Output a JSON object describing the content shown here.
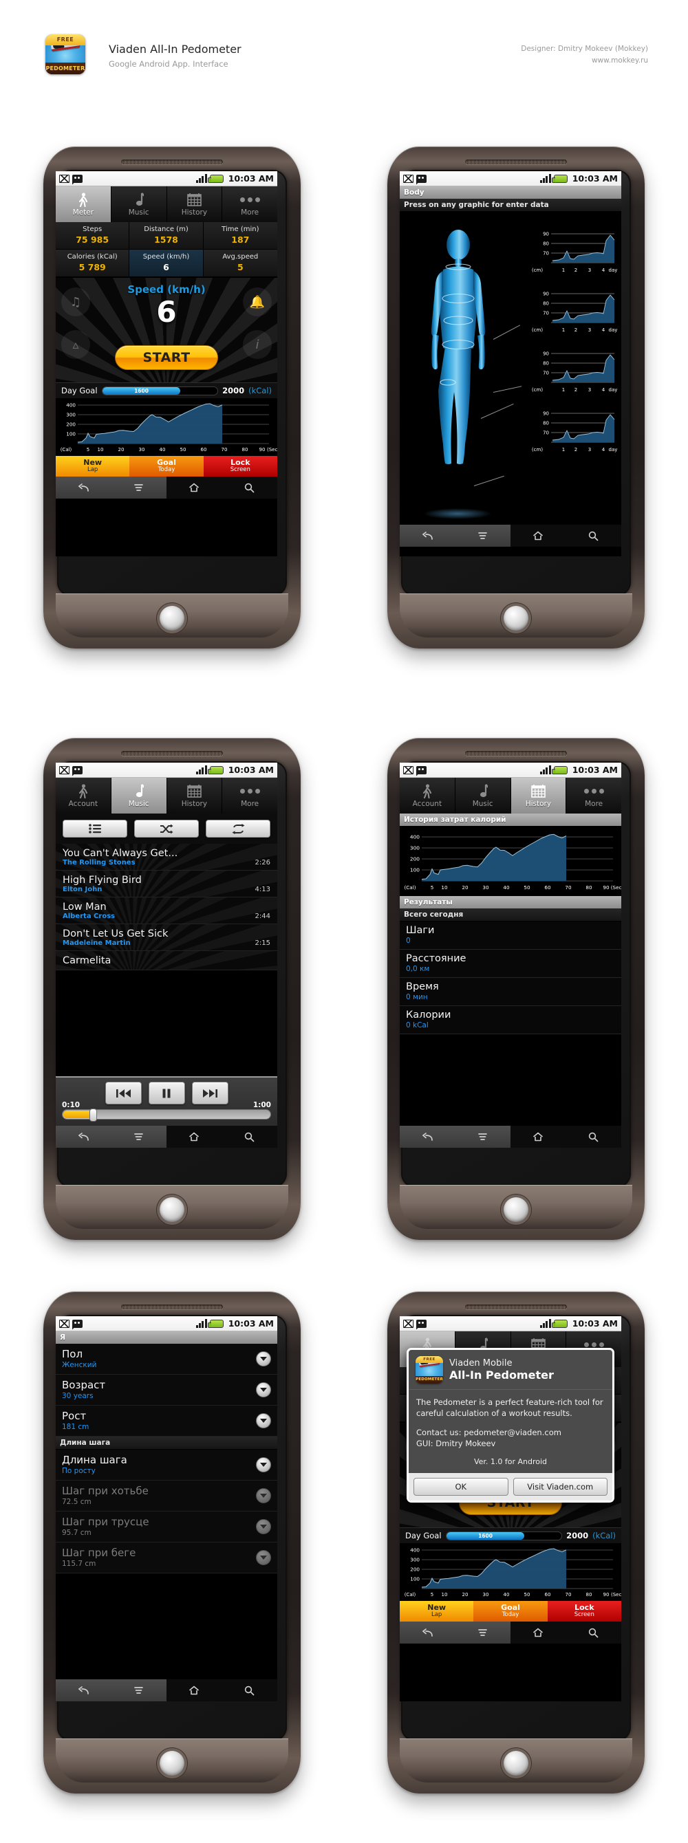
{
  "header": {
    "title": "Viaden All-In Pedometer",
    "subtitle": "Google Android App. Interface",
    "designer": "Designer: Dmitry Mokeev (Mokkey)",
    "site": "www.mokkey.ru",
    "logo_top": "FREE",
    "logo_bottom": "PEDOMETER"
  },
  "status": {
    "time": "10:03 AM"
  },
  "tabs_meter": [
    {
      "label": "Meter",
      "icon": "walking-icon",
      "active": true
    },
    {
      "label": "Music",
      "icon": "music-note-icon",
      "active": false
    },
    {
      "label": "History",
      "icon": "calendar-icon",
      "active": false
    },
    {
      "label": "More",
      "icon": "more-dots-icon",
      "active": false
    }
  ],
  "tabs_account": [
    {
      "label": "Account",
      "icon": "walking-icon",
      "active": false
    },
    {
      "label": "Music",
      "icon": "music-note-icon",
      "active": true
    },
    {
      "label": "History",
      "icon": "calendar-icon",
      "active": false
    },
    {
      "label": "More",
      "icon": "more-dots-icon",
      "active": false
    }
  ],
  "tabs_history": [
    {
      "label": "Account",
      "icon": "walking-icon",
      "active": false
    },
    {
      "label": "Music",
      "icon": "music-note-icon",
      "active": false
    },
    {
      "label": "History",
      "icon": "calendar-icon",
      "active": true
    },
    {
      "label": "More",
      "icon": "more-dots-icon",
      "active": false
    }
  ],
  "meter": {
    "stats": [
      {
        "label": "Steps",
        "value": "75 985",
        "highlight": false
      },
      {
        "label": "Distance (m)",
        "value": "1578",
        "highlight": false
      },
      {
        "label": "Time (min)",
        "value": "187",
        "highlight": false
      },
      {
        "label": "Calories (kCal)",
        "value": "5 789",
        "highlight": false
      },
      {
        "label": "Speed (km/h)",
        "value": "6",
        "highlight": true
      },
      {
        "label": "Avg.speed",
        "value": "5",
        "highlight": false
      }
    ],
    "big_label": "Speed (km/h)",
    "big_value": "6",
    "start_button": "START",
    "day_goal_label": "Day Goal",
    "day_goal_current": "1600",
    "day_goal_target": "2000",
    "day_goal_unit": "(kCal)",
    "corner_buttons": [
      "music-icon",
      "bell-icon",
      "metronome-icon",
      "info-icon"
    ],
    "actions": [
      {
        "top": "New",
        "bottom": "Lap"
      },
      {
        "top": "Goal",
        "bottom": "Today"
      },
      {
        "top": "Lock",
        "bottom": "Screen"
      }
    ]
  },
  "body_screen": {
    "title": "Body",
    "hint": "Press on any graphic for enter data"
  },
  "music": {
    "buttons": [
      "playlist-icon",
      "shuffle-icon",
      "repeat-icon"
    ],
    "tracks": [
      {
        "title": "You Can't Always Get...",
        "artist": "The Rolling Stones",
        "time": "2:26"
      },
      {
        "title": "High Flying Bird",
        "artist": "Elton John",
        "time": "4:13"
      },
      {
        "title": "Low Man",
        "artist": "Alberta Cross",
        "time": "2:44"
      },
      {
        "title": "Don't Let Us Get Sick",
        "artist": "Madeleine Martin",
        "time": "2:15"
      },
      {
        "title": "Carmelita",
        "artist": "",
        "time": ""
      }
    ],
    "player": {
      "current": "0:10",
      "duration": "1:00",
      "buttons": [
        "prev-icon",
        "pause-icon",
        "next-icon"
      ]
    }
  },
  "history": {
    "chart_title": "История затрат калорий",
    "results_title": "Результаты",
    "subtitle": "Всего сегодня",
    "rows": [
      {
        "label": "Шаги",
        "value": "0"
      },
      {
        "label": "Расстояние",
        "value": "0,0 км"
      },
      {
        "label": "Время",
        "value": "0 мин"
      },
      {
        "label": "Калории",
        "value": "0 kCal"
      }
    ]
  },
  "profile": {
    "title": "Я",
    "section": "Длина шага",
    "rows": [
      {
        "label": "Пол",
        "value": "Женский",
        "dim": false
      },
      {
        "label": "Возраст",
        "value": "30 years",
        "dim": false
      },
      {
        "label": "Рост",
        "value": "181 cm",
        "dim": false
      }
    ],
    "step_rows": [
      {
        "label": "Длина шага",
        "value": "По росту",
        "dim": false
      },
      {
        "label": "Шаг при хотьбе",
        "value": "72.5 cm",
        "dim": true
      },
      {
        "label": "Шаг при трусце",
        "value": "95.7 cm",
        "dim": true
      },
      {
        "label": "Шаг при беге",
        "value": "115.7 cm",
        "dim": true
      }
    ]
  },
  "about": {
    "brand": "Viaden Mobile",
    "app": "All-In Pedometer",
    "description": "The Pedometer is a perfect feature-rich tool for careful calculation of a workout results.",
    "contact": "Contact us: pedometer@viaden.com",
    "gui": "GUI: Dmitry Mokeev",
    "version": "Ver. 1.0 for Android",
    "ok": "OK",
    "visit": "Visit Viaden.com"
  },
  "colors": {
    "accent_blue": "#2196f3",
    "accent_amber": "#f0b400",
    "chart_fill": "#1d4f75",
    "chart_line": "#6fa8cf"
  },
  "chart_data": [
    {
      "type": "area",
      "title": "Calories over time",
      "xlabel": "(Sec)",
      "ylabel": "(Cal)",
      "ylim": [
        0,
        420
      ],
      "xlim": [
        0,
        95
      ],
      "yticks": [
        100,
        200,
        300,
        400
      ],
      "xticks": [
        5,
        10,
        20,
        30,
        40,
        50,
        60,
        70,
        80,
        90
      ],
      "x": [
        0,
        2,
        4,
        5,
        6,
        8,
        9,
        11,
        13,
        15,
        18,
        20,
        22,
        25,
        27,
        29,
        31,
        33,
        35,
        36,
        38,
        40,
        42,
        44,
        46,
        49,
        52,
        55,
        58,
        60,
        62,
        64,
        66,
        68,
        70
      ],
      "values": [
        18,
        20,
        45,
        90,
        60,
        52,
        78,
        82,
        86,
        92,
        100,
        110,
        112,
        103,
        100,
        128,
        175,
        215,
        255,
        265,
        240,
        238,
        215,
        192,
        215,
        250,
        282,
        312,
        345,
        370,
        385,
        390,
        372,
        360,
        378
      ]
    },
    {
      "type": "area",
      "title": "Body measurement history",
      "repeat": 4,
      "xlabel": "day",
      "ylabel": "(cm)",
      "ylim": [
        58,
        94
      ],
      "yticks": [
        70,
        80,
        90
      ],
      "xticks": [
        1,
        2,
        3,
        4
      ],
      "x": [
        0.1,
        0.45,
        0.8,
        1.0,
        1.2,
        1.45,
        1.6,
        1.8,
        2.0,
        2.3,
        2.6,
        2.9,
        3.1,
        3.4,
        3.7,
        3.9,
        4.1,
        4.35,
        4.6
      ],
      "values": [
        62,
        63,
        65,
        69,
        65,
        64,
        66,
        67,
        68,
        69,
        70,
        70.5,
        71,
        70.5,
        70,
        74,
        82,
        87,
        84
      ]
    }
  ]
}
